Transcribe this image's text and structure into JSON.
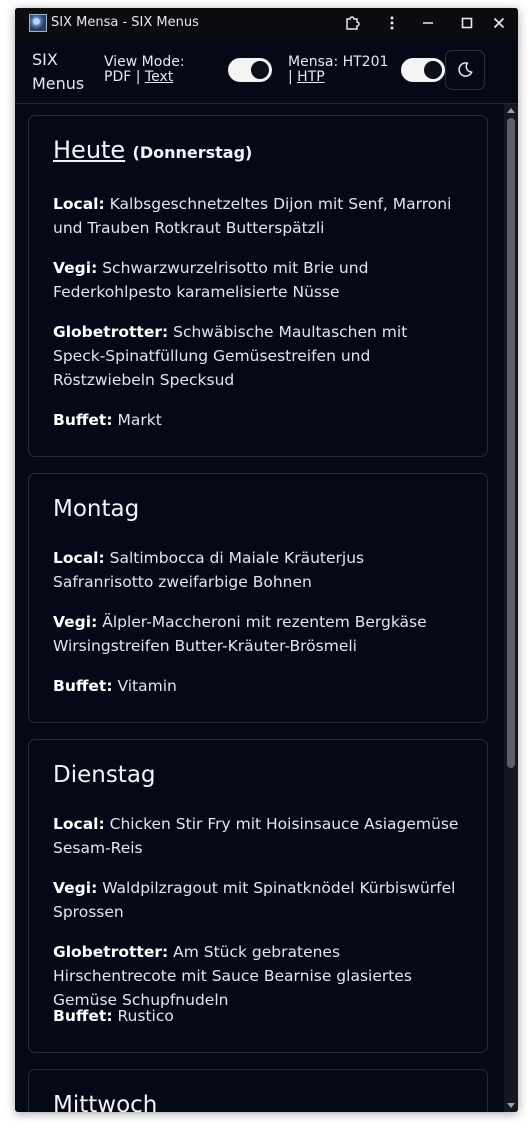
{
  "window": {
    "title": "SIX Mensa - SIX Menus",
    "icon": "globe-app-icon"
  },
  "header": {
    "brand": "SIX Menus",
    "view_mode_label": "View Mode:",
    "view_mode_pdf": "PDF",
    "view_mode_sep": "|",
    "view_mode_text": "Text",
    "mensa_label": "Mensa: HT201",
    "mensa_sep": "|",
    "mensa_htp": "HTP",
    "view_toggle_on": true,
    "mensa_toggle_on": true,
    "theme_icon": "moon-icon"
  },
  "days": [
    {
      "name": "Heute",
      "subtitle": "(Donnerstag)",
      "items": [
        {
          "label": "Local:",
          "text": "Kalbsgeschnetzeltes Dijon mit Senf, Marroni und Trauben Rotkraut Butterspätzli"
        },
        {
          "label": "Vegi:",
          "text": "Schwarzwurzelrisotto mit Brie und Federkohlpesto karamelisierte Nüsse"
        },
        {
          "label": "Globetrotter:",
          "text": "Schwäbische Maultaschen mit Speck-Spinatfüllung Gemüsestreifen und Röstzwiebeln Specksud"
        },
        {
          "label": "Buffet:",
          "text": "Markt"
        }
      ]
    },
    {
      "name": "Montag",
      "items": [
        {
          "label": "Local:",
          "text": "Saltimbocca di Maiale Kräuterjus Safranrisotto zweifarbige Bohnen"
        },
        {
          "label": "Vegi:",
          "text": "Älpler-Maccheroni mit rezentem Bergkäse Wirsingstreifen Butter-Kräuter-Brösmeli"
        },
        {
          "label": "Buffet:",
          "text": "Vitamin"
        }
      ]
    },
    {
      "name": "Dienstag",
      "items": [
        {
          "label": "Local:",
          "text": "Chicken Stir Fry mit Hoisinsauce Asiagemüse Sesam-Reis"
        },
        {
          "label": "Vegi:",
          "text": "Waldpilzragout mit Spinatknödel Kürbiswürfel Sprossen"
        },
        {
          "label": "Globetrotter:",
          "text": "Am Stück gebratenes Hirschentrecote mit Sauce Bearnise glasiertes Gemüse Schupfnudeln"
        },
        {
          "label": "Buffet:",
          "text": "Rustico"
        }
      ]
    },
    {
      "name": "Mittwoch",
      "items": []
    }
  ]
}
